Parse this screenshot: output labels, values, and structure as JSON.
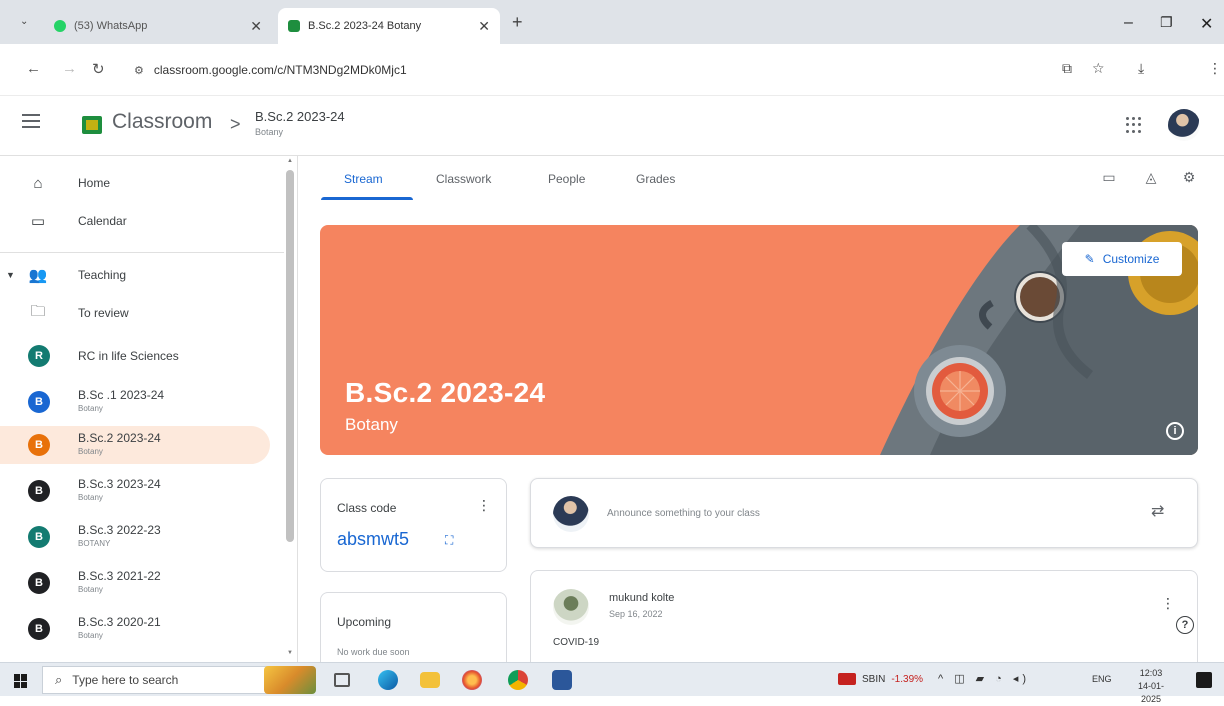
{
  "browser": {
    "tabs": [
      {
        "title": "(53) WhatsApp",
        "active": false,
        "favicon_color": "#25d366"
      },
      {
        "title": "B.Sc.2 2023-24 Botany",
        "active": true,
        "favicon_color": "#1e8e3e"
      }
    ],
    "new_tab": "+",
    "url": "classroom.google.com/c/NTM3NDg2MDk0Mjc1",
    "window_controls": {
      "minimize": "–",
      "maximize": "❐",
      "close": "✕"
    }
  },
  "header": {
    "app_name": "Classroom",
    "breadcrumb_sep": ">",
    "class_title": "B.Sc.2 2023-24",
    "class_subject": "Botany"
  },
  "sidebar": {
    "home": "Home",
    "calendar": "Calendar",
    "teaching": "Teaching",
    "to_review": "To review",
    "classes": [
      {
        "initial": "R",
        "name": "RC in life Sciences",
        "section": "",
        "color": "#137b71",
        "active": false
      },
      {
        "initial": "B",
        "name": "B.Sc .1 2023-24",
        "section": "Botany",
        "color": "#1967d2",
        "active": false
      },
      {
        "initial": "B",
        "name": "B.Sc.2 2023-24",
        "section": "Botany",
        "color": "#e8710a",
        "active": true
      },
      {
        "initial": "B",
        "name": "B.Sc.3 2023-24",
        "section": "Botany",
        "color": "#202124",
        "active": false
      },
      {
        "initial": "B",
        "name": "B.Sc.3 2022-23",
        "section": "BOTANY",
        "color": "#137b71",
        "active": false
      },
      {
        "initial": "B",
        "name": "B.Sc.3 2021-22",
        "section": "Botany",
        "color": "#202124",
        "active": false
      },
      {
        "initial": "B",
        "name": "B.Sc.3 2020-21",
        "section": "Botany",
        "color": "#202124",
        "active": false
      }
    ]
  },
  "tabs": {
    "stream": "Stream",
    "classwork": "Classwork",
    "people": "People",
    "grades": "Grades"
  },
  "banner": {
    "title": "B.Sc.2 2023-24",
    "subject": "Botany",
    "customize": "Customize",
    "info_icon": "i",
    "color": "#f5845f"
  },
  "class_code": {
    "label": "Class code",
    "value": "absmwt5"
  },
  "upcoming": {
    "title": "Upcoming",
    "note": "No work due soon"
  },
  "announce": {
    "placeholder": "Announce something to your class"
  },
  "post": {
    "author": "mukund kolte",
    "date": "Sep 16, 2022",
    "body": "COVID-19"
  },
  "taskbar": {
    "search_placeholder": "Type here to search",
    "stock_name": "SBIN",
    "stock_change": "-1.39%",
    "tray_lang": "ENG",
    "time": "12:03",
    "date": "14-01-2025"
  }
}
